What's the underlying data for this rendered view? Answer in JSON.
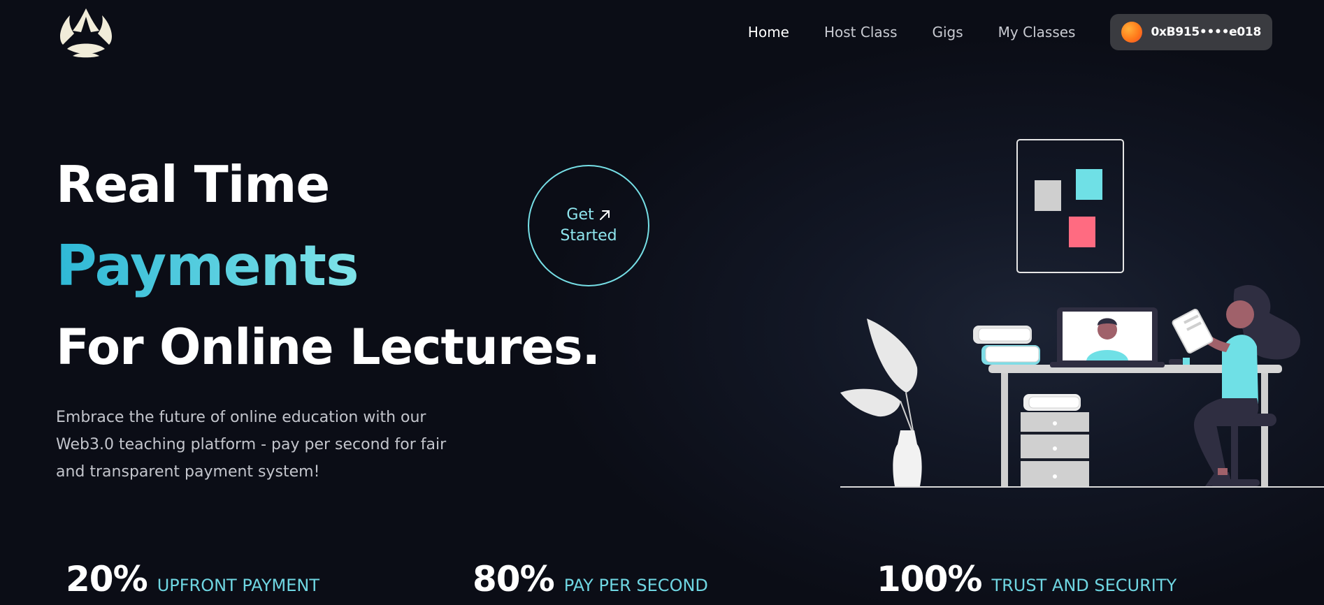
{
  "nav": {
    "links": [
      {
        "label": "Home",
        "active": true
      },
      {
        "label": "Host Class",
        "active": false
      },
      {
        "label": "Gigs",
        "active": false
      },
      {
        "label": "My Classes",
        "active": false
      }
    ],
    "wallet": {
      "address": "0xB915••••e018",
      "avatar_icon": "wallet-avatar-icon"
    }
  },
  "hero": {
    "line1": "Real Time",
    "line2": "Payments",
    "line3": "For Online Lectures.",
    "description": "Embrace the future of online education with our Web3.0 teaching platform - pay per second for fair and transparent payment system!",
    "cta": {
      "line1": "Get",
      "line2": "Started",
      "icon": "arrow-up-right-icon"
    }
  },
  "stats": [
    {
      "value": "20%",
      "label": "UPFRONT PAYMENT"
    },
    {
      "value": "80%",
      "label": "PAY PER SECOND"
    },
    {
      "value": "100%",
      "label": "TRUST AND SECURITY"
    }
  ],
  "colors": {
    "background": "#0b0d16",
    "accent": "#6fd6e2",
    "accent_gradient_start": "#2eb8d6",
    "accent_gradient_end": "#7fe3e8",
    "wallet_bg": "#3a3b40",
    "illustration_red": "#ff6b81"
  }
}
